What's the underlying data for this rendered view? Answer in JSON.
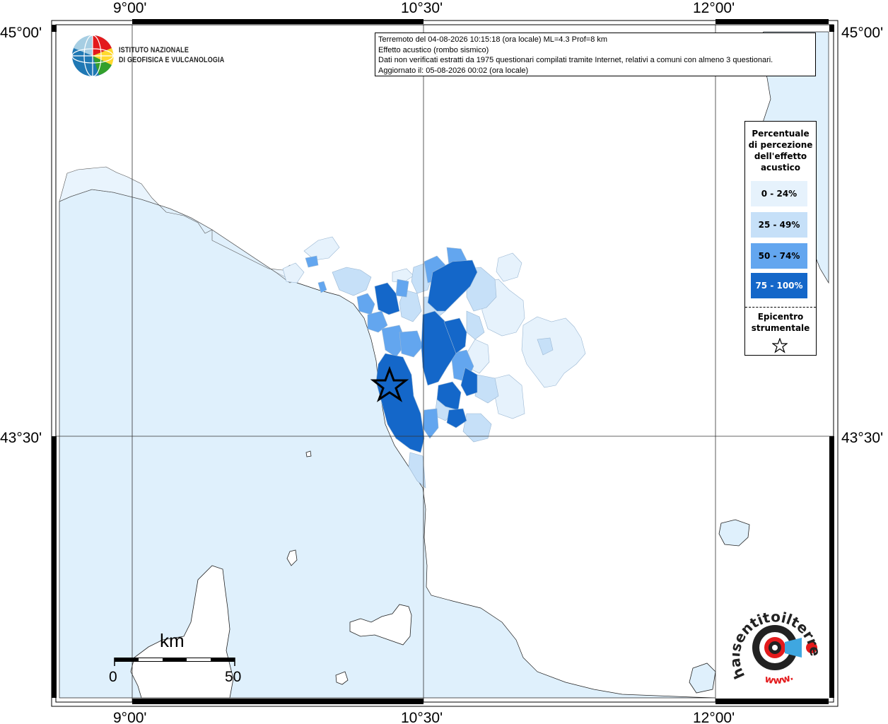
{
  "header": {
    "title_line": "Terremoto del 04-08-2026 10:15:18 (ora locale) ML=4.3 Prof=8 km",
    "effect_line": "Effetto acustico (rombo sismico)",
    "source_line": "Dati non verificati estratti da 1975 questionari compilati tramite Internet, relativi a comuni con almeno 3 questionari.",
    "updated_line": "Aggiornato il: 05-08-2026 00:02 (ora locale)"
  },
  "logo": {
    "line1": "ISTITUTO NAZIONALE",
    "line2": "DI GEOFISICA E VULCANOLOGIA"
  },
  "axes": {
    "top": [
      "9°00'",
      "10°30'",
      "12°00'"
    ],
    "bottom": [
      "9°00'",
      "10°30'",
      "12°00'"
    ],
    "left": [
      "45°00'",
      "43°30'"
    ],
    "right": [
      "45°00'",
      "43°30'"
    ]
  },
  "legend": {
    "title": "Percentuale di percezione dell'effetto acustico",
    "title_lines": [
      "Percentuale",
      "di percezione",
      "dell'effetto",
      "acustico"
    ],
    "classes": [
      {
        "label": "0 - 24%",
        "color": "#e6f2fc"
      },
      {
        "label": "25 - 49%",
        "color": "#c6e0f8"
      },
      {
        "label": "50 - 74%",
        "color": "#63a6ef"
      },
      {
        "label": "75 - 100%",
        "color": "#1467c9"
      }
    ],
    "epicenter_lines": [
      "Epicentro",
      "strumentale"
    ]
  },
  "scale_bar": {
    "unit": "km",
    "start": "0",
    "end": "50"
  },
  "colors": {
    "sea": "#dff0fc",
    "land": "#ffffff",
    "frame": "#000000"
  },
  "badge": {
    "text": "haisentitoilterremoto.it",
    "url_text": "www."
  }
}
